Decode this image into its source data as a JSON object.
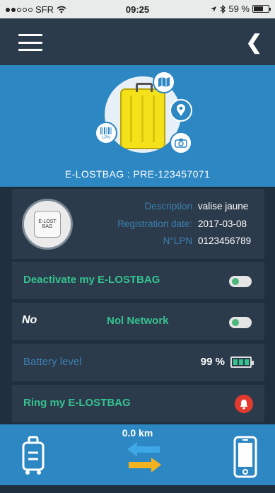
{
  "status_bar": {
    "carrier": "SFR",
    "time": "09:25",
    "battery": "59 %"
  },
  "bag": {
    "id_line": "E-LOSTBAG : PRE-123457071"
  },
  "device": {
    "fields": [
      {
        "key": "Description",
        "value": "valise jaune"
      },
      {
        "key": "Registration date:",
        "value": "2017-03-08"
      },
      {
        "key": "N°LPN",
        "value": "0123456789"
      }
    ]
  },
  "rows": {
    "deactivate": "Deactivate my E-LOSTBAG",
    "network": "Nol Network",
    "network_logo": "No",
    "battery_label": "Battery level",
    "battery_value": "99 %",
    "ring": "Ring my E-LOSTBAG"
  },
  "bottom": {
    "distance": "0.0 km"
  },
  "icons": {
    "menu": "hamburger-icon",
    "back": "chevron-left-icon",
    "lpn": "barcode-icon",
    "map": "map-icon",
    "location": "location-pin-icon",
    "camera": "camera-icon",
    "bell": "bell-icon",
    "luggage": "luggage-icon",
    "transfer": "transfer-arrows-icon",
    "phone": "smartphone-icon"
  },
  "colors": {
    "accent": "#2d87c3",
    "panel": "#2c3b4b",
    "green": "#35c28f",
    "alert": "#e23b2e"
  }
}
